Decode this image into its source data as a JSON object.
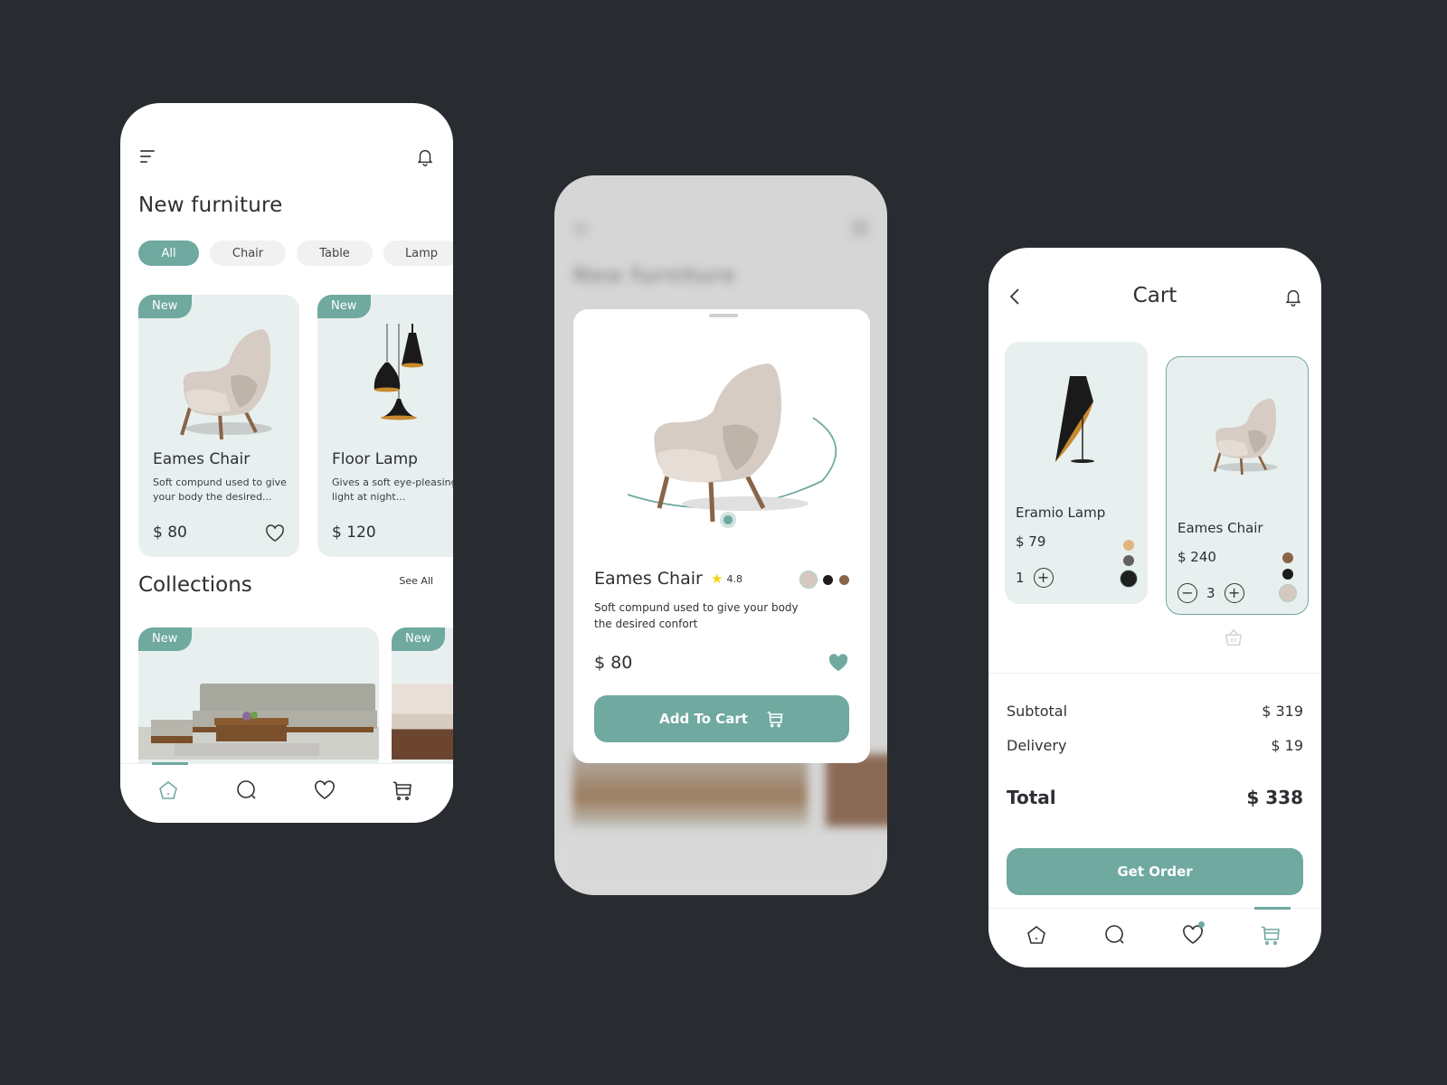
{
  "colors": {
    "accent": "#6fa9a0",
    "background": "#282b30",
    "card": "#e8f0ef"
  },
  "home": {
    "menu_icon": "menu-icon",
    "bell_icon": "bell-icon",
    "title": "New furniture",
    "filters": [
      {
        "label": "All",
        "active": true
      },
      {
        "label": "Chair",
        "active": false
      },
      {
        "label": "Table",
        "active": false
      },
      {
        "label": "Lamp",
        "active": false
      }
    ],
    "products": [
      {
        "badge": "New",
        "name": "Eames Chair",
        "description": "Soft compund used to give your body the desired...",
        "price": "$ 80"
      },
      {
        "badge": "New",
        "name": "Floor Lamp",
        "description": "Gives a soft eye-pleasing light at night...",
        "price": "$ 120"
      }
    ],
    "collections_title": "Collections",
    "see_all": "See All",
    "collections": [
      {
        "badge": "New"
      },
      {
        "badge": "New"
      }
    ],
    "nav": [
      "home-icon",
      "search-icon",
      "heart-icon",
      "cart-icon"
    ],
    "nav_active": "home"
  },
  "detail": {
    "background_title": "New furniture",
    "name": "Eames Chair",
    "rating": "4.8",
    "colors": [
      "#d5c9bf",
      "#1d1d1d",
      "#8a6447"
    ],
    "selected_color": "#d5c9bf",
    "description": "Soft compund used to give your body the desired confort",
    "price": "$ 80",
    "favorited": true,
    "add_to_cart": "Add To Cart"
  },
  "cart": {
    "title": "Cart",
    "items": [
      {
        "name": "Eramio Lamp",
        "price": "$ 79",
        "quantity": "1",
        "colors": [
          "#e2b47e",
          "#626262",
          "#1f1f1f"
        ],
        "selected_color": "#1f1f1f",
        "selected": false
      },
      {
        "name": "Eames Chair",
        "price": "$ 240",
        "quantity": "3",
        "colors": [
          "#8a6447",
          "#1d1d1d",
          "#d5c9bf"
        ],
        "selected_color": "#d5c9bf",
        "selected": true
      }
    ],
    "subtotal_label": "Subtotal",
    "subtotal": "$ 319",
    "delivery_label": "Delivery",
    "delivery": "$ 19",
    "total_label": "Total",
    "total": "$ 338",
    "order_button": "Get Order",
    "nav_active": "cart",
    "favorites_notification": true
  }
}
